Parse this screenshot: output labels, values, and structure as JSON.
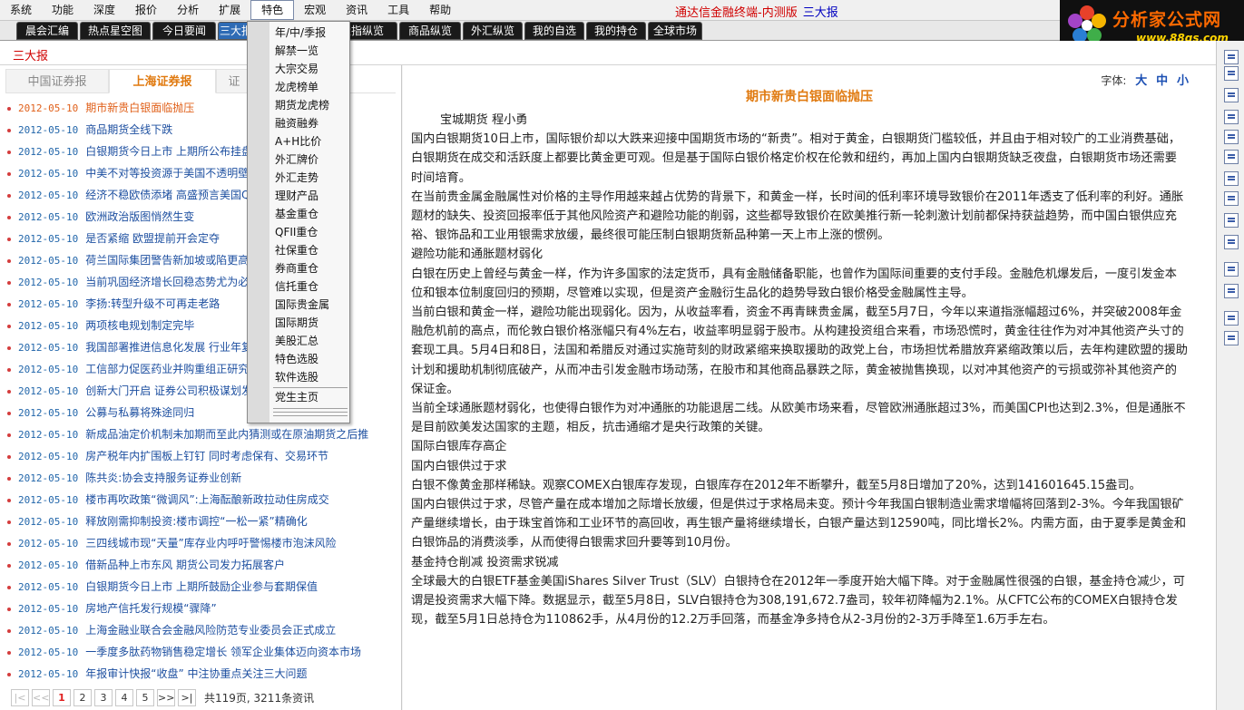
{
  "menubar": {
    "items": [
      "系统",
      "功能",
      "深度",
      "报价",
      "分析",
      "扩展",
      "特色",
      "宏观",
      "资讯",
      "工具",
      "帮助"
    ],
    "active_index": 6,
    "app_title": "通达信金融终端-内测版",
    "app_subtitle": "三大报"
  },
  "logo": {
    "brand": "分析家公式网",
    "url": "www.88gs.com"
  },
  "tabs": [
    "晨会汇编",
    "热点星空图",
    "今日要闻",
    "三大报",
    "股指纵览",
    "商品纵览",
    "外汇纵览",
    "我的自选",
    "我的持仓",
    "全球市场"
  ],
  "section_title": "三大报",
  "left_tabs": [
    "中国证券报",
    "上海证券报",
    "证"
  ],
  "news": [
    {
      "date": "2012-05-10",
      "title": "期市新贵白银面临抛压"
    },
    {
      "date": "2012-05-10",
      "title": "商品期货全线下跌"
    },
    {
      "date": "2012-05-10",
      "title": "白银期货今日上市 上期所公布挂盘"
    },
    {
      "date": "2012-05-10",
      "title": "中美不对等投资源于美国不透明壁垒"
    },
    {
      "date": "2012-05-10",
      "title": "经济不稳欧债添堵 高盛预言美国QE"
    },
    {
      "date": "2012-05-10",
      "title": "欧洲政治版图悄然生变"
    },
    {
      "date": "2012-05-10",
      "title": "是否紧缩 欧盟提前开会定夺"
    },
    {
      "date": "2012-05-10",
      "title": "荷兰国际集团警告新加坡或陷更高通"
    },
    {
      "date": "2012-05-10",
      "title": "当前巩固经济增长回稳态势尤为必要"
    },
    {
      "date": "2012-05-10",
      "title": "李扬:转型升级不可再走老路"
    },
    {
      "date": "2012-05-10",
      "title": "两项核电规划制定完毕"
    },
    {
      "date": "2012-05-10",
      "title": "我国部署推进信息化发展 行业年复合增长率20%"
    },
    {
      "date": "2012-05-10",
      "title": "工信部力促医药业并购重组正研究制"
    },
    {
      "date": "2012-05-10",
      "title": "创新大门开启 证券公司积极谋划发"
    },
    {
      "date": "2012-05-10",
      "title": "公募与私募将殊途同归"
    },
    {
      "date": "2012-05-10",
      "title": "新成品油定价机制未加期而至此内猜测或在原油期货之后推"
    },
    {
      "date": "2012-05-10",
      "title": "房产税年内扩围板上钉钉 同时考虑保有、交易环节"
    },
    {
      "date": "2012-05-10",
      "title": "陈共炎:协会支持服务证券业创新"
    },
    {
      "date": "2012-05-10",
      "title": "楼市再吹政策“微调风”:上海酝酿新政拉动住房成交"
    },
    {
      "date": "2012-05-10",
      "title": "释放刚需抑制投资:楼市调控“一松一紧”精确化"
    },
    {
      "date": "2012-05-10",
      "title": "三四线城市现“天量”库存业内呼吁警惕楼市泡沫风险"
    },
    {
      "date": "2012-05-10",
      "title": "借新品种上市东风 期货公司发力拓展客户"
    },
    {
      "date": "2012-05-10",
      "title": "白银期货今日上市 上期所鼓励企业参与套期保值"
    },
    {
      "date": "2012-05-10",
      "title": "房地产信托发行规模“骤降”"
    },
    {
      "date": "2012-05-10",
      "title": "上海金融业联合会金融风险防范专业委员会正式成立"
    },
    {
      "date": "2012-05-10",
      "title": "一季度多肽药物销售稳定增长 领军企业集体迈向资本市场"
    },
    {
      "date": "2012-05-10",
      "title": "年报审计快报“收盘” 中注协重点关注三大问题"
    }
  ],
  "pager": {
    "first": "|<",
    "prev": "<<",
    "pages": [
      "1",
      "2",
      "3",
      "4",
      "5"
    ],
    "current": "1",
    "next": ">>",
    "last": ">|",
    "info": "共119页, 3211条资讯"
  },
  "article": {
    "font_label": "字体:",
    "font_options": [
      "大",
      "中",
      "小"
    ],
    "title": "期市新贵白银面临抛压",
    "author": "宝城期货 程小勇",
    "paragraphs": [
      "国内白银期货10日上市，国际银价却以大跌来迎接中国期货市场的“新贵”。相对于黄金，白银期货门槛较低，并且由于相对较广的工业消费基础，白银期货在成交和活跃度上都要比黄金更可观。但是基于国际白银价格定价权在伦敦和纽约，再加上国内白银期货缺乏夜盘，白银期货市场还需要时间培育。",
      "在当前贵金属金融属性对价格的主导作用越来越占优势的背景下，和黄金一样，长时间的低利率环境导致银价在2011年透支了低利率的利好。通胀题材的缺失、投资回报率低于其他风险资产和避险功能的削弱，这些都导致银价在欧美推行新一轮刺激计划前都保持获益趋势，而中国白银供应充裕、银饰品和工业用银需求放缓，最终很可能压制白银期货新品种第一天上市上涨的惯例。",
      "避险功能和通胀题材弱化",
      "白银在历史上曾经与黄金一样，作为许多国家的法定货币，具有金融储备职能，也曾作为国际间重要的支付手段。金融危机爆发后，一度引发金本位和银本位制度回归的预期，尽管难以实现，但是资产金融衍生品化的趋势导致白银价格受金融属性主导。",
      "当前白银和黄金一样，避险功能出现弱化。因为，从收益率看，资金不再青睐贵金属，截至5月7日，今年以来道指涨幅超过6%，并突破2008年金融危机前的高点，而伦敦白银价格涨幅只有4%左右，收益率明显弱于股市。从构建投资组合来看，市场恐慌时，黄金往往作为对冲其他资产头寸的套现工具。5月4日和8日，法国和希腊反对通过实施苛刻的财政紧缩来换取援助的政党上台，市场担忧希腊放弃紧缩政策以后，去年构建欧盟的援助计划和援助机制彻底破产，从而冲击引发金融市场动荡，在股市和其他商品暴跌之际，黄金被抛售换现，以对冲其他资产的亏损或弥补其他资产的保证金。",
      "当前全球通胀题材弱化，也使得白银作为对冲通胀的功能退居二线。从欧美市场来看，尽管欧洲通胀超过3%，而美国CPI也达到2.3%，但是通胀不是目前欧美发达国家的主题，相反，抗击通缩才是央行政策的关键。",
      "国际白银库存高企",
      "国内白银供过于求",
      "白银不像黄金那样稀缺。观察COMEX白银库存发现，白银库存在2012年不断攀升，截至5月8日增加了20%，达到141601645.15盎司。",
      "国内白银供过于求，尽管产量在成本增加之际增长放缓，但是供过于求格局未变。预计今年我国白银制造业需求增幅将回落到2-3%。今年我国银矿产量继续增长，由于珠宝首饰和工业环节的高回收，再生银产量将继续增长，白银产量达到12590吨，同比增长2%。内需方面，由于夏季是黄金和白银饰品的消费淡季，从而使得白银需求回升要等到10月份。",
      "基金持仓削减 投资需求锐减",
      "全球最大的白银ETF基金美国iShares Silver Trust（SLV）白银持仓在2012年一季度开始大幅下降。对于金融属性很强的白银，基金持仓减少，可谓是投资需求大幅下降。数据显示，截至5月8日，SLV白银持仓为308,191,672.7盎司，较年初降幅为2.1%。从CFTC公布的COMEX白银持仓发现，截至5月1日总持仓为110862手，从4月份的12.2万手回落，而基金净多持仓从2-3月份的2-3万手降至1.6万手左右。"
    ]
  },
  "dropdown": {
    "items": [
      "年/中/季报",
      "解禁一览",
      "大宗交易",
      "龙虎榜单",
      "期货龙虎榜",
      "融资融券",
      "A+H比价",
      "外汇牌价",
      "外汇走势",
      "理财产品",
      "基金重仓",
      "QFII重仓",
      "社保重仓",
      "券商重仓",
      "信托重仓",
      "国际贵金属",
      "国际期货",
      "美股汇总",
      "特色选股",
      "软件选股"
    ],
    "footer_item": "党生主页"
  },
  "colors": {
    "accent_orange": "#e07a10",
    "title_red": "#d00000",
    "link_blue": "#1d4fa0",
    "tab_selected": "#2e6bb5"
  }
}
